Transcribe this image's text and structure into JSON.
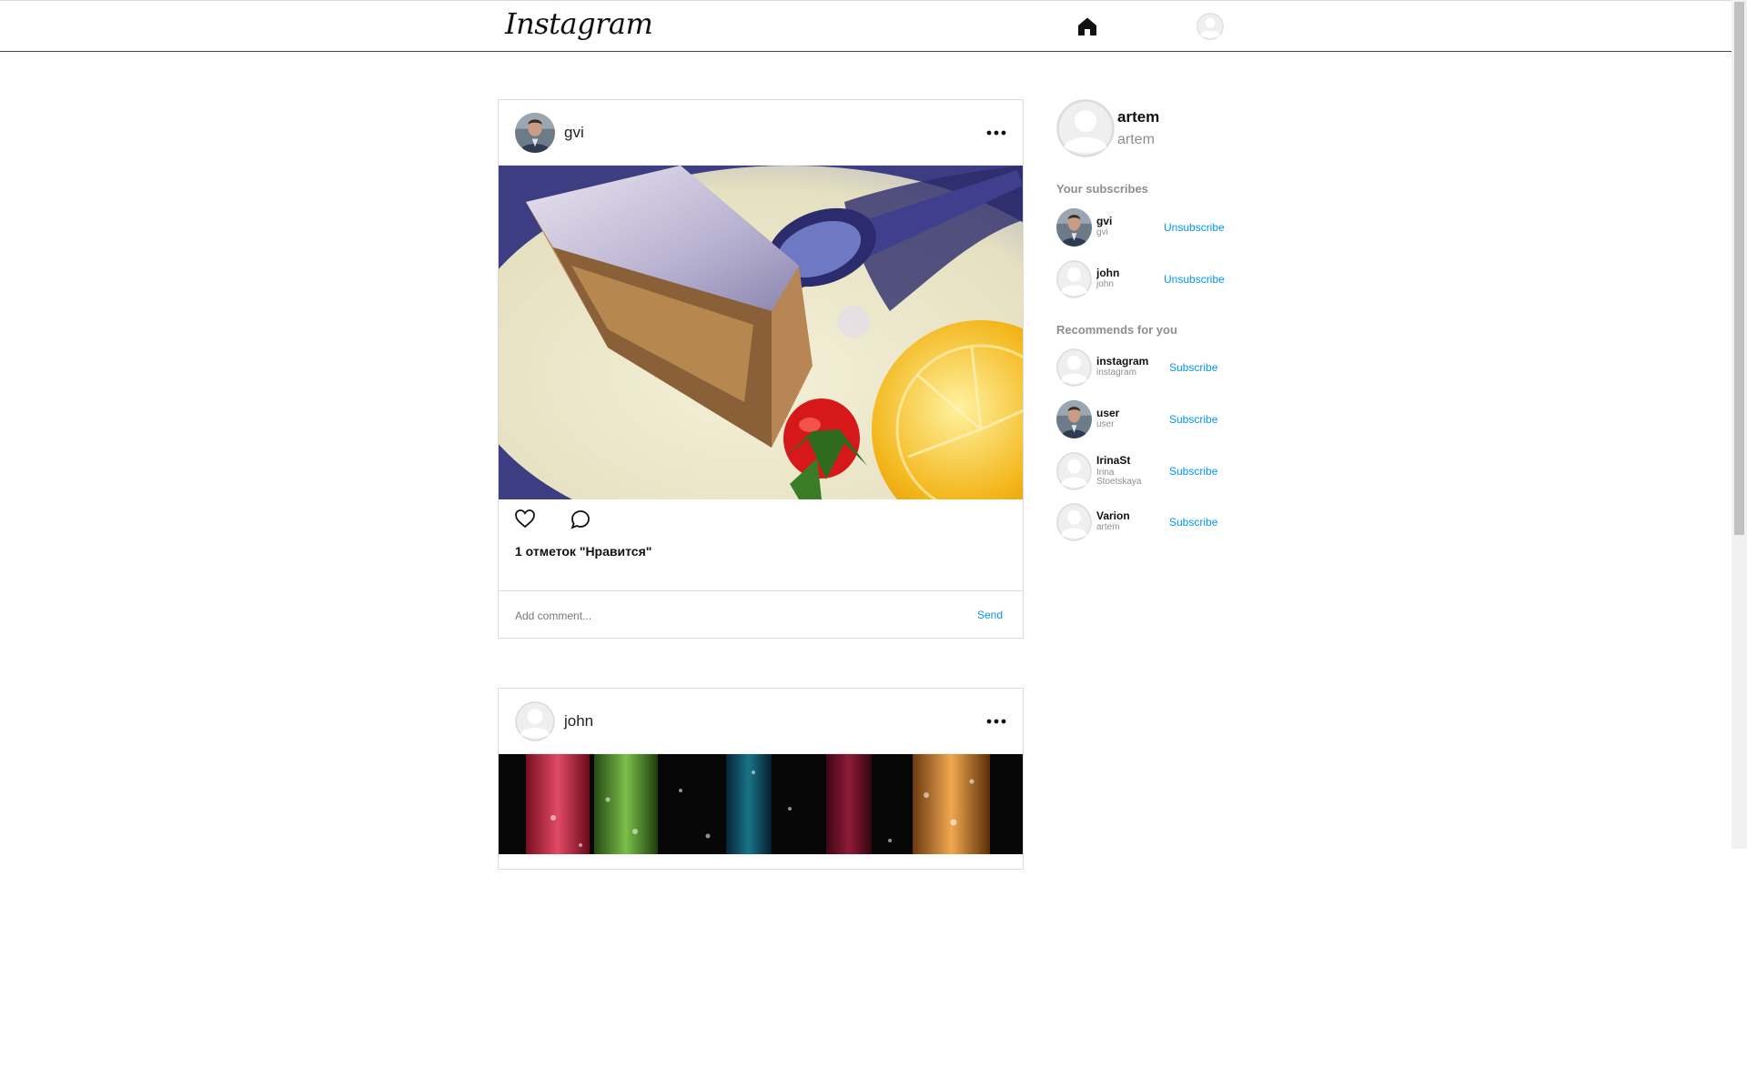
{
  "header": {
    "logo": "Instagram",
    "home_icon": "home-icon",
    "profile_icon": "avatar-icon"
  },
  "posts": [
    {
      "username": "gvi",
      "more_icon": "more-dots-icon",
      "image_alt": "apple strudel with vanilla sauce, strawberry and orange",
      "like_icon": "heart-icon",
      "comment_icon": "comment-bubble-icon",
      "likes_text": "1 отметок \"Нравится\"",
      "comment_placeholder": "Add comment...",
      "send_label": "Send"
    },
    {
      "username": "john",
      "more_icon": "more-dots-icon",
      "image_alt": "colorful drinking straws with bubbles"
    }
  ],
  "sidebar": {
    "me": {
      "name": "artem",
      "username": "artem"
    },
    "subscribes_title": "Your subscribes",
    "subscribes": [
      {
        "name": "gvi",
        "username": "gvi",
        "action": "Unsubscribe"
      },
      {
        "name": "john",
        "username": "john",
        "action": "Unsubscribe"
      }
    ],
    "recommends_title": "Recommends for you",
    "recommends": [
      {
        "name": "instagram",
        "username": "instagram",
        "action": "Subscribe"
      },
      {
        "name": "user",
        "username": "user",
        "action": "Subscribe"
      },
      {
        "name": "IrinaSt",
        "username": "Irina Stoetskaya",
        "action": "Subscribe"
      },
      {
        "name": "Varion",
        "username": "artem",
        "action": "Subscribe"
      }
    ]
  },
  "colors": {
    "accent": "#0095f6",
    "muted": "#8e8e8e",
    "border": "#dbdbdb"
  }
}
